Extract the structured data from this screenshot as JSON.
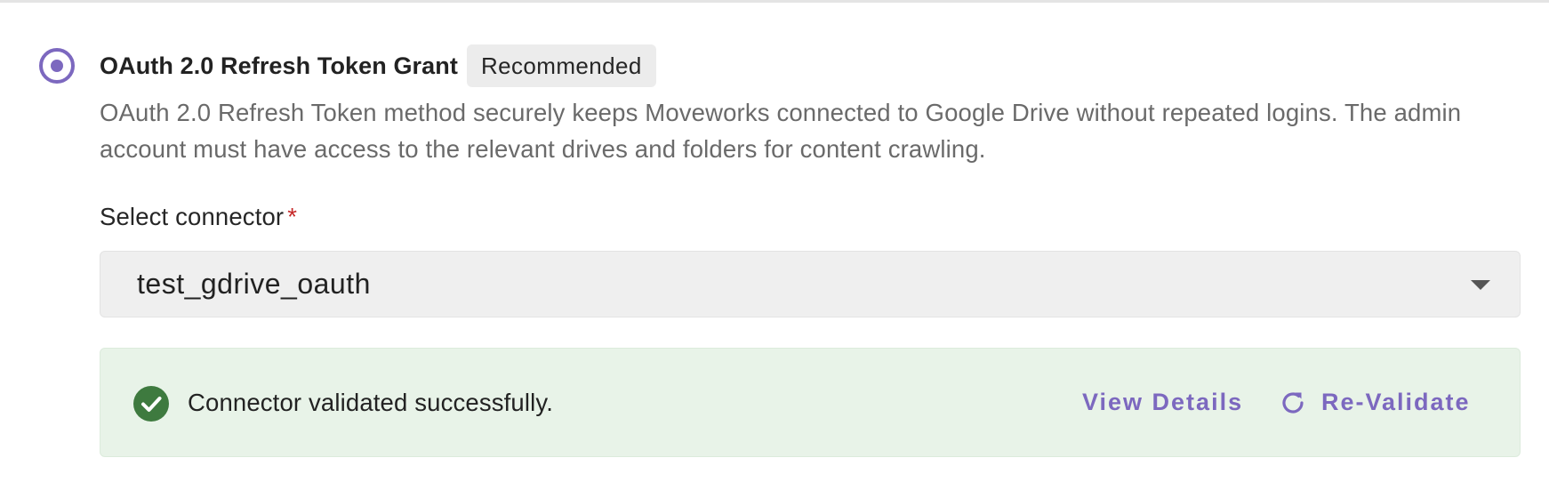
{
  "auth_option": {
    "title": "OAuth 2.0 Refresh Token Grant",
    "badge": "Recommended",
    "description": "OAuth 2.0 Refresh Token method securely keeps Moveworks connected to Google Drive without repeated logins. The admin account must have access to the relevant drives and folders for content crawling.",
    "selected": true
  },
  "connector_field": {
    "label": "Select connector",
    "required_marker": "*",
    "selected_value": "test_gdrive_oauth"
  },
  "validation_alert": {
    "message": "Connector validated successfully.",
    "view_details_label": "View Details",
    "revalidate_label": "Re-Validate"
  },
  "icons": {
    "status": "check-circle-icon",
    "revalidate": "refresh-icon",
    "dropdown": "chevron-down-icon"
  },
  "colors": {
    "accent": "#7c68bf",
    "success": "#3e7a3f",
    "success_background": "#e8f3e8",
    "required": "#c62828"
  }
}
